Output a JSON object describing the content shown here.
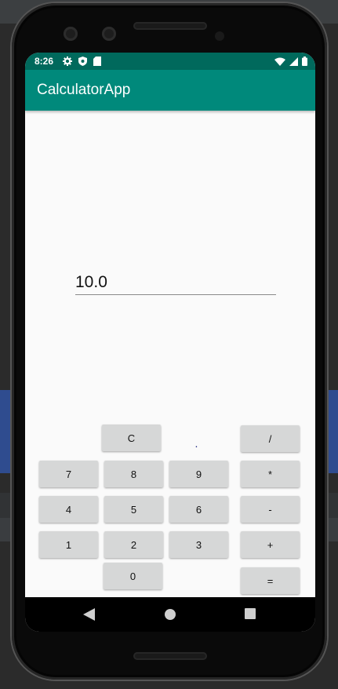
{
  "status_bar": {
    "time": "8:26",
    "icons_left": [
      "settings-icon",
      "shield-icon",
      "sd-card-icon"
    ],
    "icons_right": [
      "wifi-icon",
      "signal-icon",
      "battery-icon"
    ]
  },
  "app_bar": {
    "title": "CalculatorApp"
  },
  "display": {
    "value": "10.0"
  },
  "keypad": {
    "row0": {
      "clear": "C",
      "dot": ".",
      "divide": "/"
    },
    "row1": {
      "k7": "7",
      "k8": "8",
      "k9": "9",
      "multiply": "*"
    },
    "row2": {
      "k4": "4",
      "k5": "5",
      "k6": "6",
      "minus": "-"
    },
    "row3": {
      "k1": "1",
      "k2": "2",
      "k3": "3",
      "plus": "+"
    },
    "row4": {
      "k0": "0",
      "equals": "="
    }
  },
  "nav_bar": {
    "buttons": [
      "back-icon",
      "home-icon",
      "recents-icon"
    ]
  },
  "colors": {
    "status_bar": "#00695c",
    "app_bar": "#00897b",
    "key": "#d6d7d7",
    "dot_key_text": "#1a237e"
  }
}
